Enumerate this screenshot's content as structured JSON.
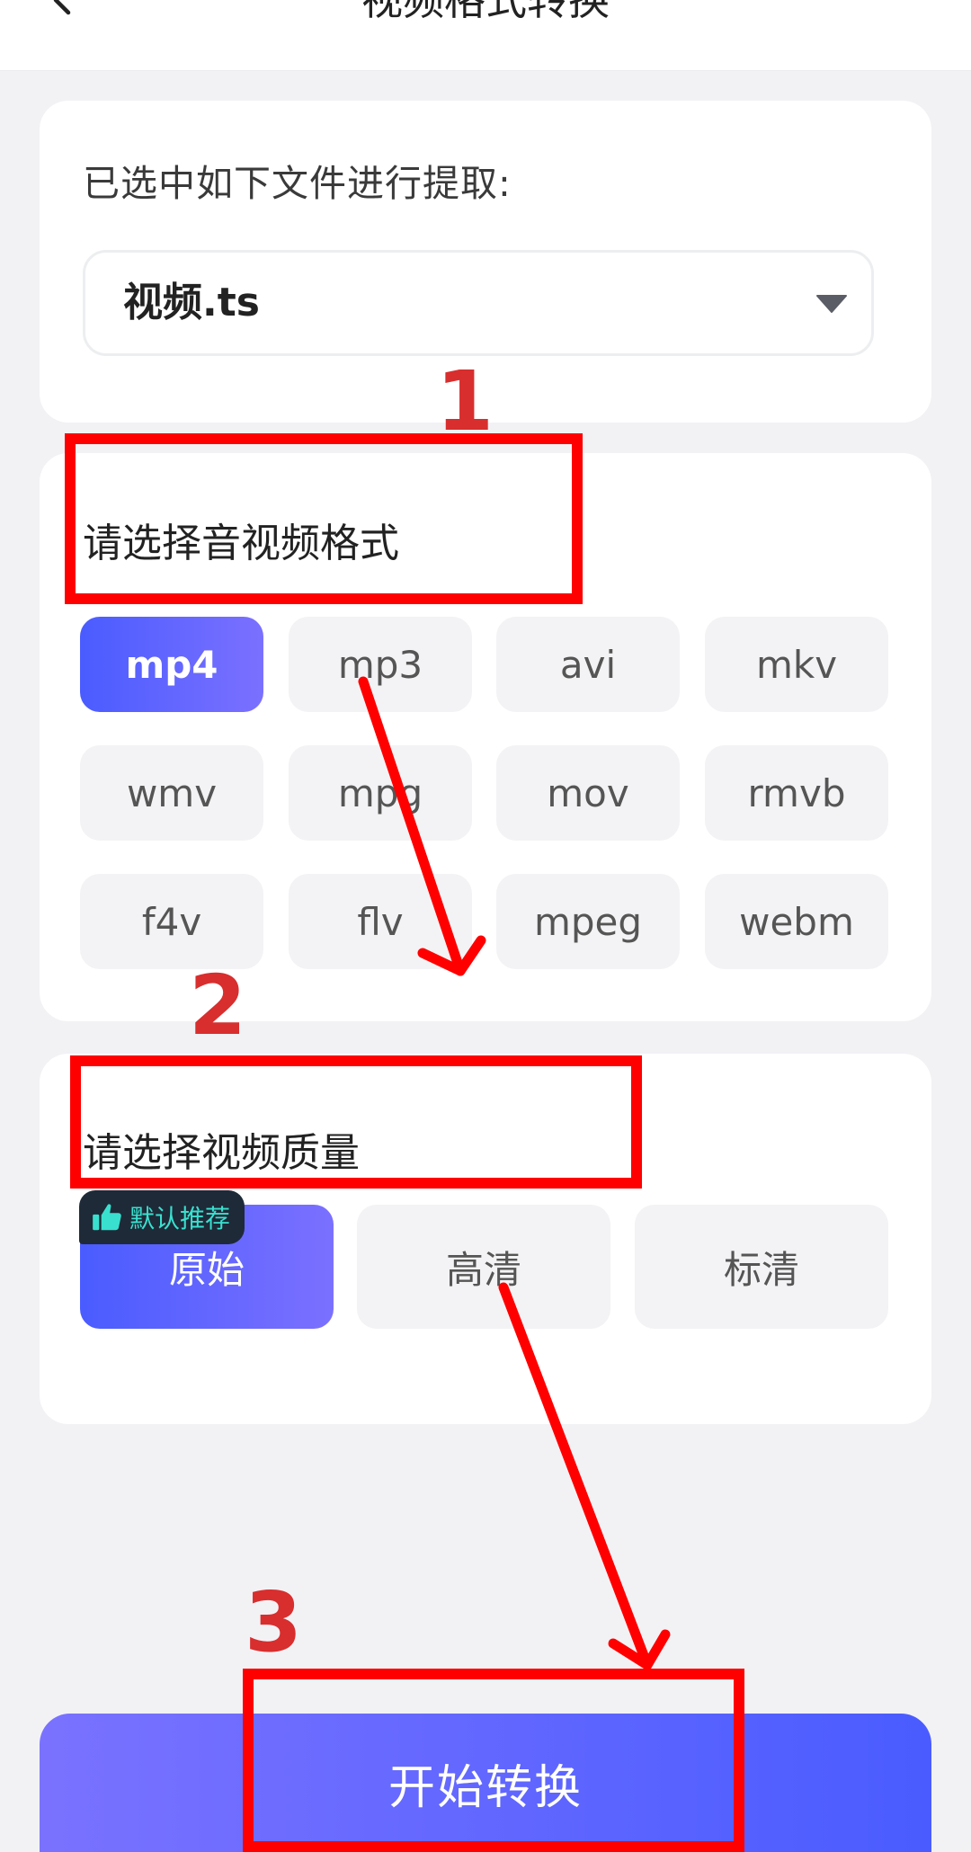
{
  "header": {
    "title": "视频格式转换",
    "back_icon": "chevron-left-icon"
  },
  "file_card": {
    "label": "已选中如下文件进行提取:",
    "selected_file": "视频.ts",
    "dropdown_icon": "caret-down-icon"
  },
  "format_card": {
    "title": "请选择音视频格式",
    "selected": "mp4",
    "formats": [
      "mp4",
      "mp3",
      "avi",
      "mkv",
      "wmv",
      "mpg",
      "mov",
      "rmvb",
      "f4v",
      "flv",
      "mpeg",
      "webm"
    ]
  },
  "quality_card": {
    "title": "请选择视频质量",
    "badge_label": "默认推荐",
    "badge_icon": "thumbs-up-icon",
    "selected": "原始",
    "options": [
      "原始",
      "高清",
      "标清"
    ]
  },
  "start_button": {
    "label": "开始转换"
  },
  "annotations": {
    "step_labels": [
      "1",
      "2",
      "3"
    ]
  },
  "colors": {
    "accent_start": "#4a5cff",
    "accent_end": "#7b70ff",
    "annotation_red": "#ff0000",
    "annotation_number": "#d82e2e",
    "badge_bg": "#1e2a38",
    "badge_text": "#39e0cf"
  }
}
